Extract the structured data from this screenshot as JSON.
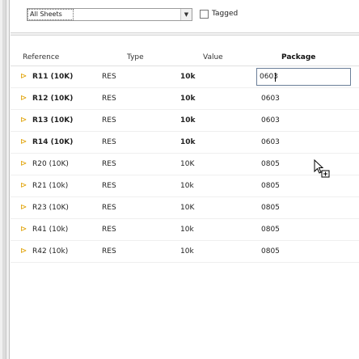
{
  "toolbar": {
    "sheet_filter_value": "All Sheets",
    "tagged_label": "Tagged",
    "tagged_checked": false
  },
  "table": {
    "headers": {
      "reference": "Reference",
      "type": "Type",
      "value": "Value",
      "package": "Package"
    },
    "editing_package_value": "0603",
    "rows": [
      {
        "reference": "R11 (10K)",
        "type": "RES",
        "value": "10k",
        "package": "",
        "bold": true
      },
      {
        "reference": "R12 (10K)",
        "type": "RES",
        "value": "10k",
        "package": "0603",
        "bold": true
      },
      {
        "reference": "R13 (10K)",
        "type": "RES",
        "value": "10k",
        "package": "0603",
        "bold": true
      },
      {
        "reference": "R14 (10K)",
        "type": "RES",
        "value": "10k",
        "package": "0603",
        "bold": true
      },
      {
        "reference": "R20 (10K)",
        "type": "RES",
        "value": "10K",
        "package": "0805",
        "bold": false
      },
      {
        "reference": "R21 (10k)",
        "type": "RES",
        "value": "10k",
        "package": "0805",
        "bold": false
      },
      {
        "reference": "R23 (10K)",
        "type": "RES",
        "value": "10K",
        "package": "0805",
        "bold": false
      },
      {
        "reference": "R41 (10k)",
        "type": "RES",
        "value": "10k",
        "package": "0805",
        "bold": false
      },
      {
        "reference": "R42 (10k)",
        "type": "RES",
        "value": "10k",
        "package": "0805",
        "bold": false
      }
    ]
  },
  "icons": {
    "row_expand": "chevron-right-icon",
    "dropdown": "chevron-down-icon",
    "cursor": "copy-cursor-icon"
  },
  "colors": {
    "row_chevron": "#e0a000",
    "input_border": "#6b7f99"
  }
}
